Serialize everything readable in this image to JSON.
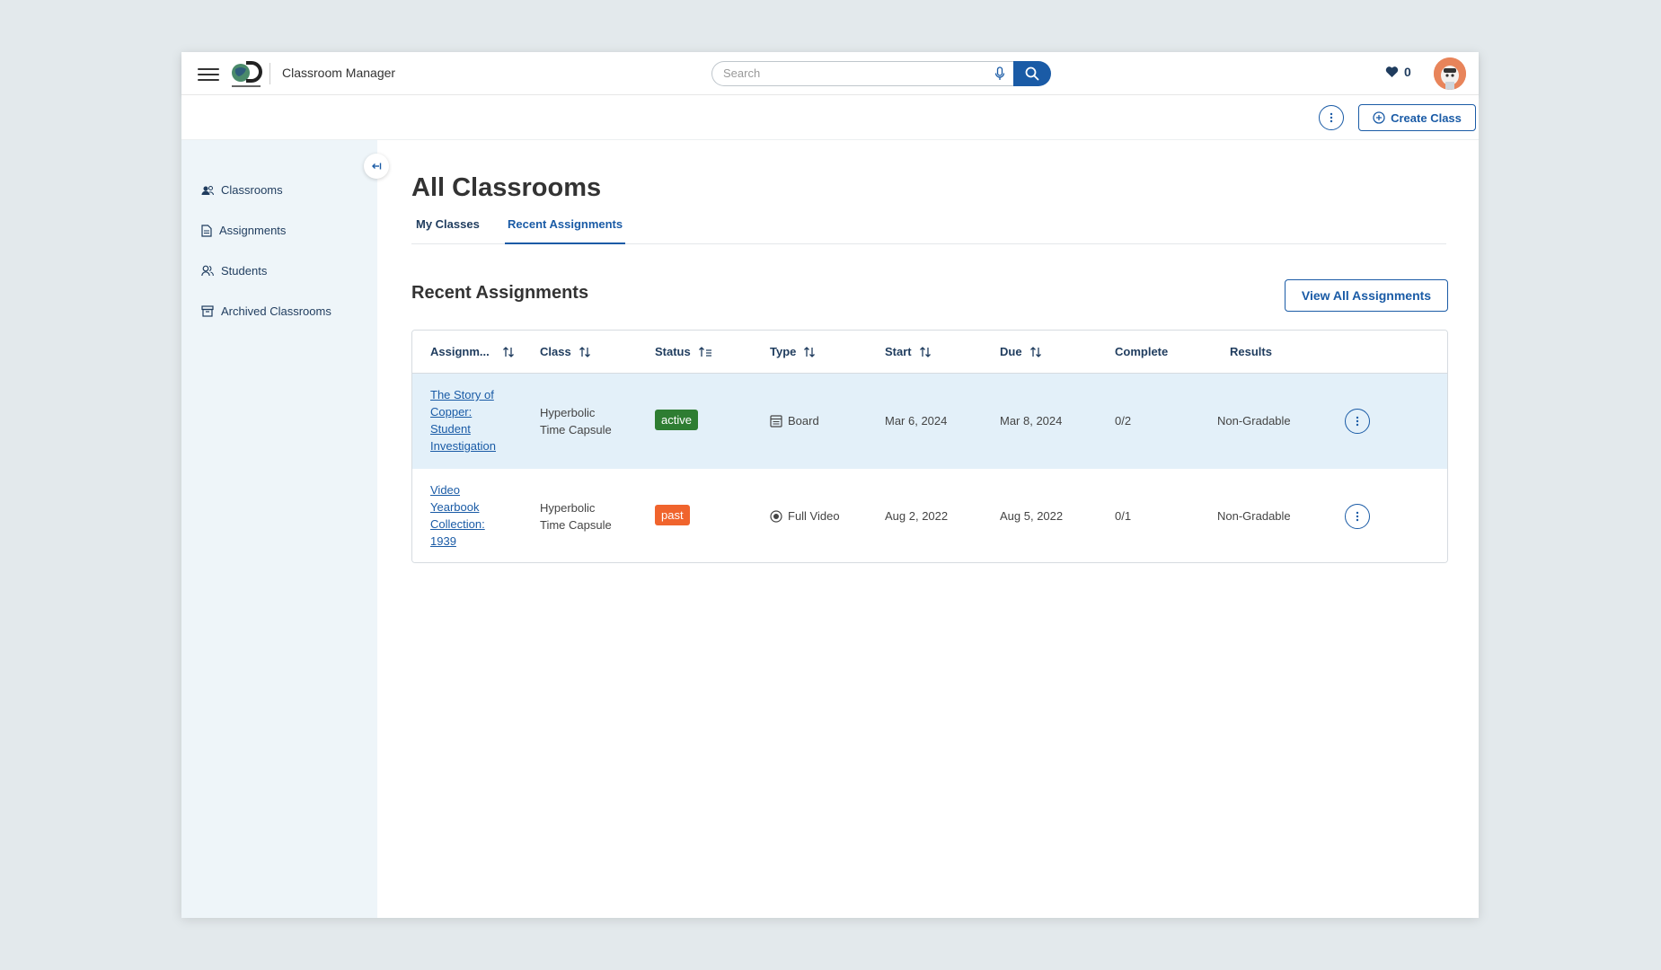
{
  "header": {
    "app_title": "Classroom Manager",
    "search_placeholder": "Search",
    "favorites_count": "0"
  },
  "subbar": {
    "create_class_label": "Create Class"
  },
  "sidebar": {
    "items": [
      {
        "label": "Classrooms",
        "icon": "classrooms-icon"
      },
      {
        "label": "Assignments",
        "icon": "document-icon"
      },
      {
        "label": "Students",
        "icon": "students-icon"
      },
      {
        "label": "Archived Classrooms",
        "icon": "archive-icon"
      }
    ]
  },
  "main": {
    "page_title": "All Classrooms",
    "tabs": [
      {
        "label": "My Classes",
        "active": false
      },
      {
        "label": "Recent Assignments",
        "active": true
      }
    ],
    "section_title": "Recent Assignments",
    "view_all_label": "View All Assignments"
  },
  "table": {
    "columns": [
      "Assignm...",
      "Class",
      "Status",
      "Type",
      "Start",
      "Due",
      "Complete",
      "Results"
    ],
    "rows": [
      {
        "assignment_lines": [
          "The Story of",
          "Copper:",
          "Student",
          "Investigation"
        ],
        "class_lines": [
          "Hyperbolic",
          "Time Capsule"
        ],
        "status": "active",
        "type": "Board",
        "start": "Mar 6, 2024",
        "due": "Mar 8, 2024",
        "complete": "0/2",
        "results": "Non-Gradable"
      },
      {
        "assignment_lines": [
          "Video",
          "Yearbook",
          "Collection:",
          "1939"
        ],
        "class_lines": [
          "Hyperbolic",
          "Time Capsule"
        ],
        "status": "past",
        "type": "Full Video",
        "start": "Aug 2, 2022",
        "due": "Aug 5, 2022",
        "complete": "0/1",
        "results": "Non-Gradable"
      }
    ]
  },
  "colors": {
    "accent": "#1a5ba6",
    "status_active": "#2e7d32",
    "status_past": "#f0642d",
    "sidebar_bg": "#eef5f9",
    "row_highlight": "#e3f0f9"
  }
}
